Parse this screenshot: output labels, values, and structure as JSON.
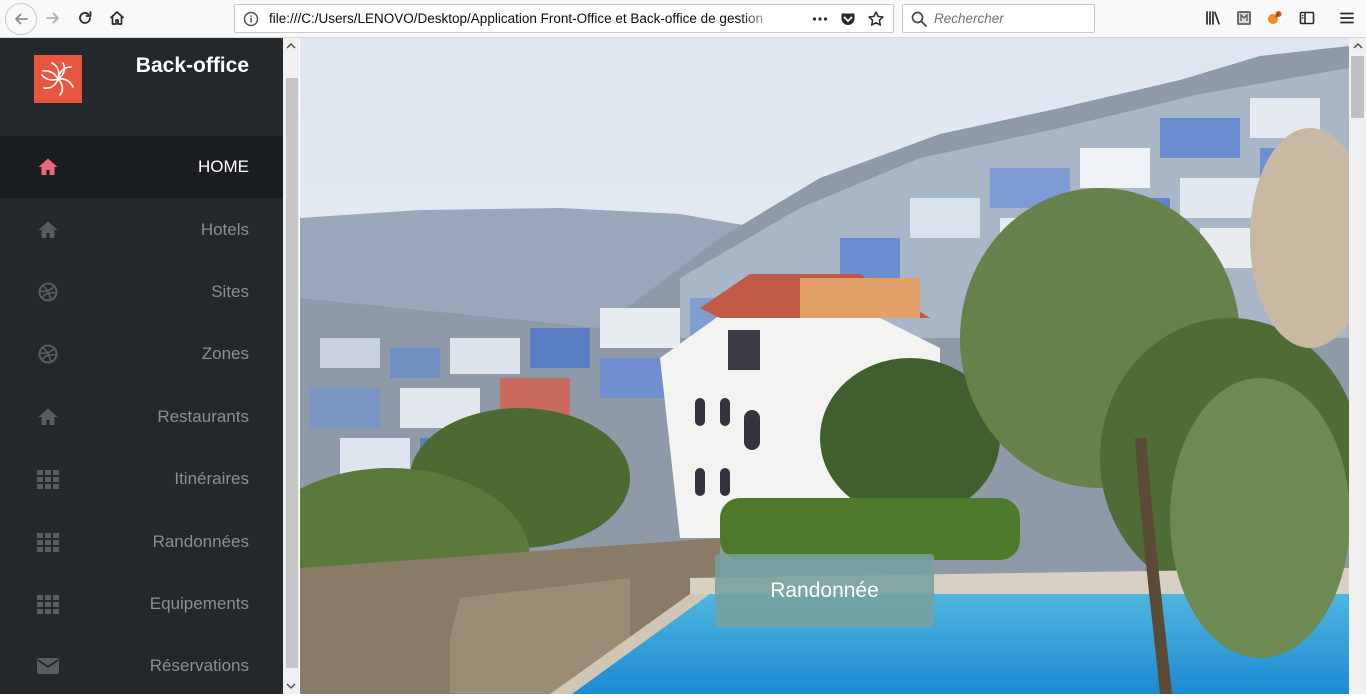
{
  "browser": {
    "url": "file:///C:/Users/LENOVO/Desktop/Application Front-Office et Back-office de gestion",
    "search_placeholder": "Rechercher",
    "icons": [
      "back-arrow-icon",
      "forward-arrow-icon",
      "reload-icon",
      "home-icon",
      "info-icon",
      "more-dots-icon",
      "pocket-icon",
      "bookmark-star-icon",
      "search-icon",
      "library-icon",
      "reader-icon",
      "extension-icon",
      "sidebar-icon",
      "menu-icon"
    ]
  },
  "sidebar": {
    "brand": "Back-office",
    "items": [
      {
        "label": "HOME",
        "icon": "home-icon",
        "active": true
      },
      {
        "label": "Hotels",
        "icon": "home-icon",
        "active": false
      },
      {
        "label": "Sites",
        "icon": "dribbble-icon",
        "active": false
      },
      {
        "label": "Zones",
        "icon": "dribbble-icon",
        "active": false
      },
      {
        "label": "Restaurants",
        "icon": "home-icon",
        "active": false
      },
      {
        "label": "Itinéraires",
        "icon": "grid-icon",
        "active": false
      },
      {
        "label": "Randonnées",
        "icon": "grid-icon",
        "active": false
      },
      {
        "label": "Equipements",
        "icon": "grid-icon",
        "active": false
      },
      {
        "label": "Réservations",
        "icon": "envelope-icon",
        "active": false
      }
    ]
  },
  "hero": {
    "button_label": "Randonnée"
  },
  "colors": {
    "sidebar_bg": "#24282b",
    "active_bg": "#1b1e21",
    "active_icon": "#e8697b",
    "logo": "#e8563f",
    "button": "#78a0a0"
  }
}
